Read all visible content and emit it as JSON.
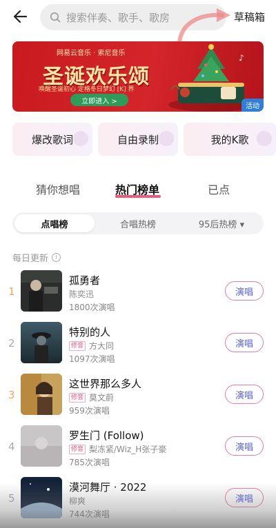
{
  "header": {
    "search_placeholder": "搜索伴奏、歌手、歌房",
    "drafts_label": "草稿箱"
  },
  "banner": {
    "brand": "网易云音乐 · 索尼音乐",
    "title": "圣诞欢乐颂",
    "subtitle": "唤醒圣诞初心  定格冬日梦幻  [K]  界",
    "button_label": "立即进入 >",
    "tag": "活动"
  },
  "quick_actions": [
    {
      "label": "爆改歌词"
    },
    {
      "label": "自由录制"
    },
    {
      "label": "我的K歌"
    }
  ],
  "tabs": [
    {
      "label": "猜你想唱"
    },
    {
      "label": "热门榜单"
    },
    {
      "label": "已点"
    }
  ],
  "segments": [
    {
      "label": "点唱榜"
    },
    {
      "label": "合唱热榜"
    },
    {
      "label": "95后热榜 ▾"
    }
  ],
  "daily_label": "每日更新",
  "songs": [
    {
      "rank": "1",
      "title": "孤勇者",
      "artist": "陈奕迅",
      "badge": "",
      "plays": "1800次演唱",
      "sing": "演唱"
    },
    {
      "rank": "2",
      "title": "特别的人",
      "artist": "方大同",
      "badge": "修音",
      "plays": "1097次演唱",
      "sing": "演唱"
    },
    {
      "rank": "3",
      "title": "这世界那么多人",
      "artist": "莫文蔚",
      "badge": "修音",
      "plays": "959次演唱",
      "sing": "演唱"
    },
    {
      "rank": "4",
      "title": "罗生门 (Follow)",
      "artist": "梨冻紧/Wiz_H张子豪",
      "badge": "修音",
      "plays": "785次演唱",
      "sing": "演唱"
    },
    {
      "rank": "5",
      "title": "漠河舞厅 · 2022",
      "artist": "柳爽",
      "badge": "",
      "plays": "744次演唱",
      "sing": "演唱"
    }
  ],
  "colors": {
    "accent": "#ef5a7a",
    "sing_text": "#5a64e0",
    "rank_top": "#f2a657",
    "banner_red": "#c81a1f"
  }
}
